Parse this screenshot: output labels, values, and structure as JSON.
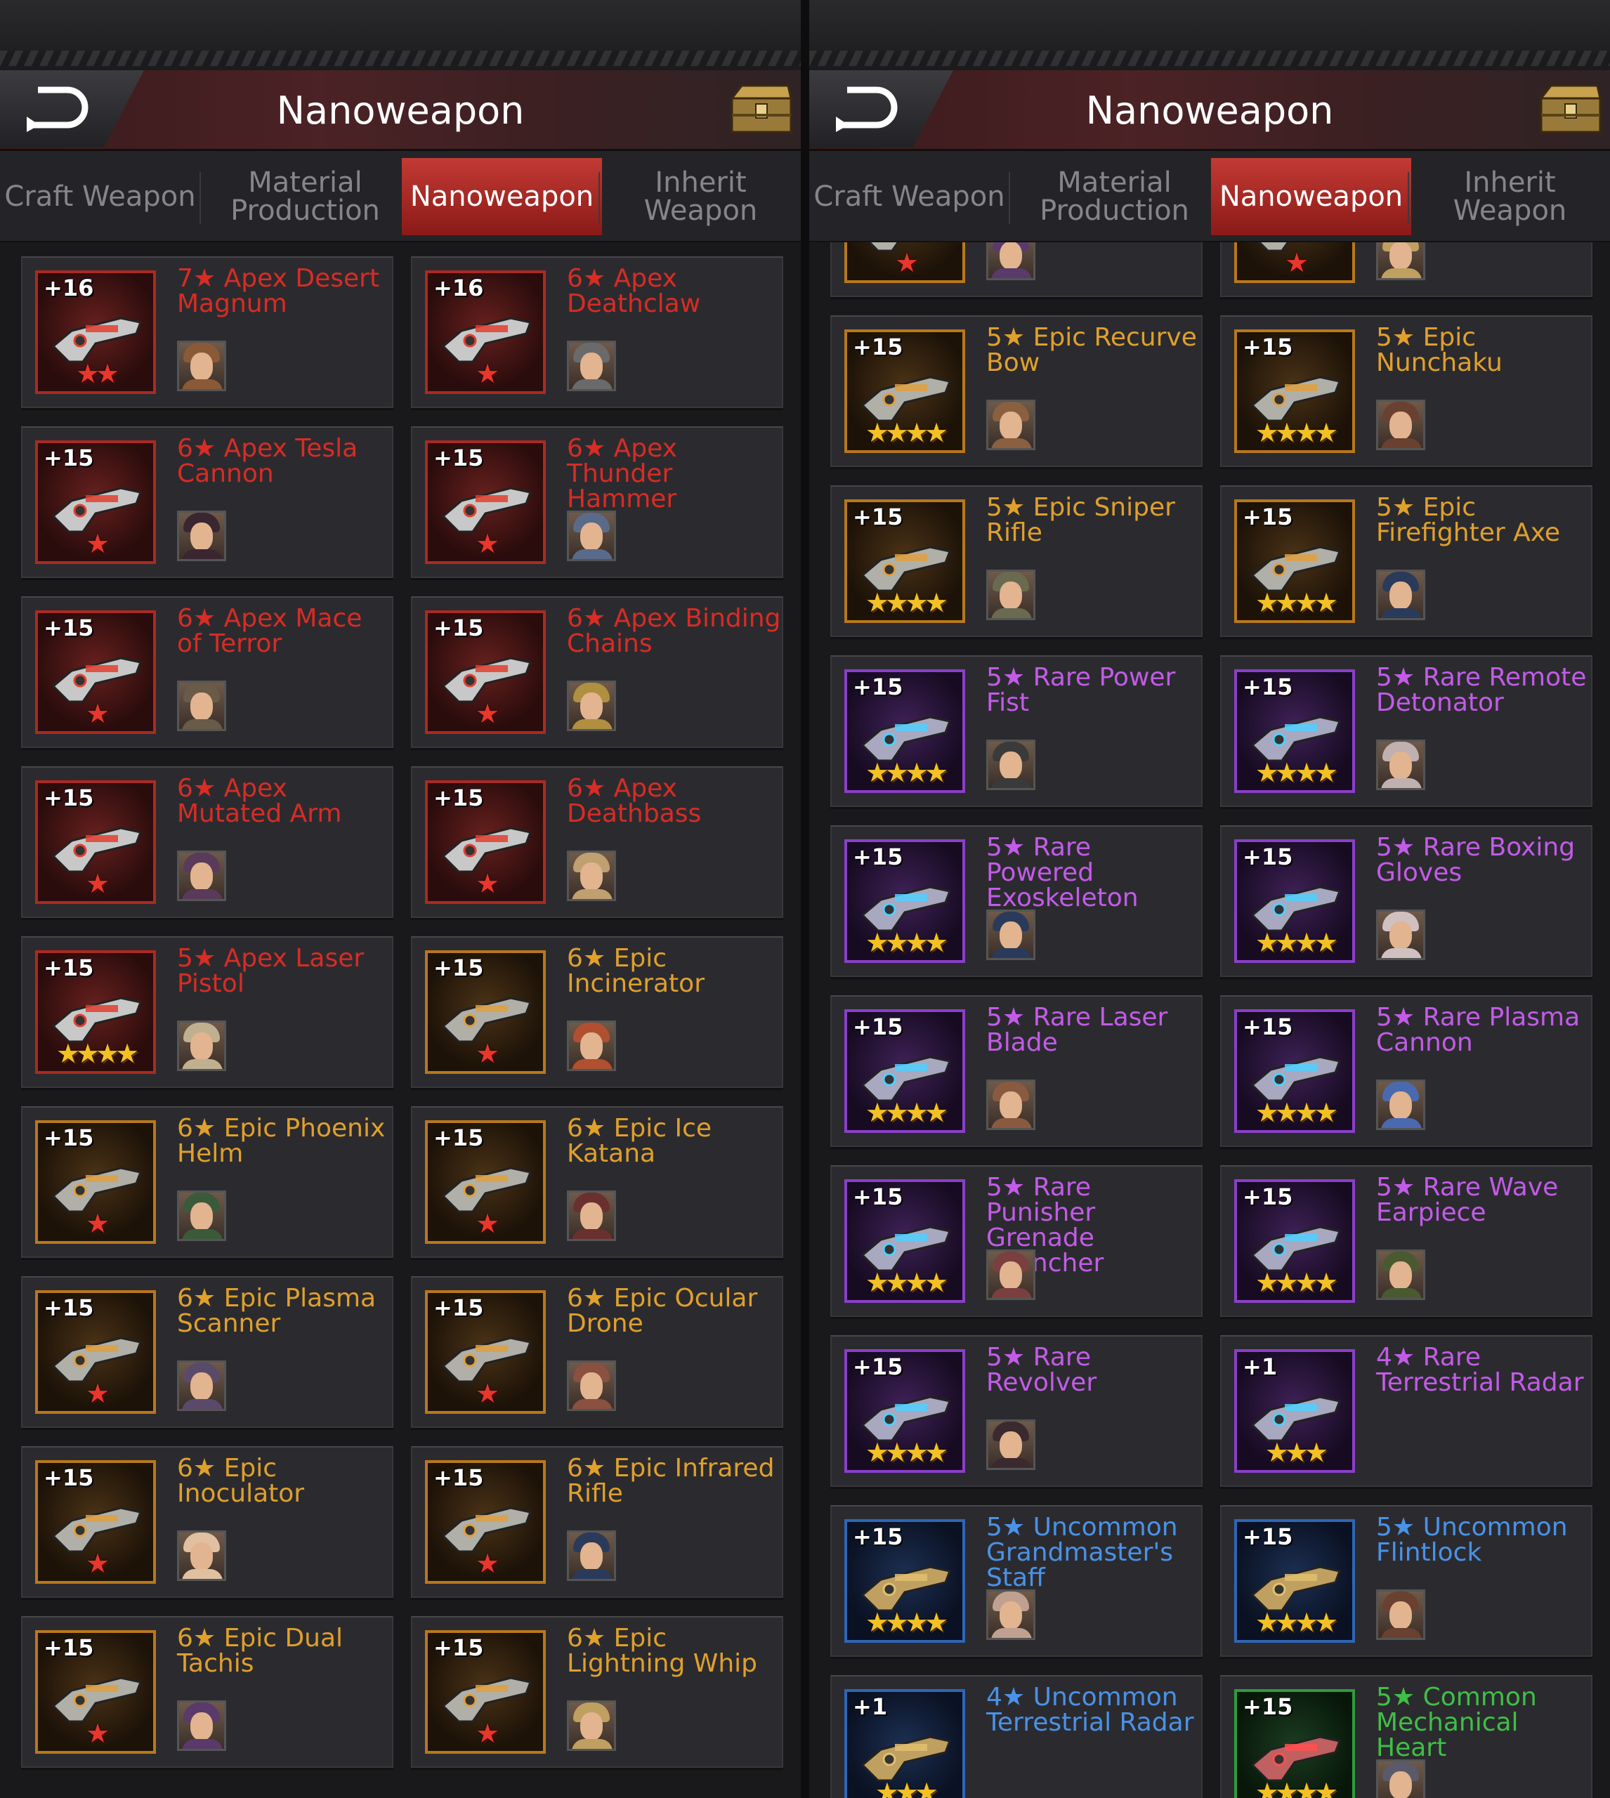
{
  "screens": {
    "left": {
      "title": "Nanoweapon",
      "tabs": [
        {
          "label": "Craft Weapon",
          "active": false
        },
        {
          "label": "Material Production",
          "active": false
        },
        {
          "label": "Nanoweapon",
          "active": true
        },
        {
          "label": "Inherit Weapon",
          "active": false
        }
      ],
      "items": [
        {
          "level": "+16",
          "name": "7★ Apex Desert Magnum",
          "rarity": "apex",
          "stars": "★★",
          "star_color": "red",
          "icon": "desert-magnum-icon",
          "hero_color": "#8a5a38"
        },
        {
          "level": "+16",
          "name": "6★ Apex Deathclaw",
          "rarity": "apex",
          "stars": "★",
          "star_color": "red",
          "icon": "deathclaw-icon",
          "hero_color": "#6a6a6a"
        },
        {
          "level": "+15",
          "name": "6★ Apex Tesla Cannon",
          "rarity": "apex",
          "stars": "★",
          "star_color": "red",
          "icon": "tesla-cannon-icon",
          "hero_color": "#3a2630"
        },
        {
          "level": "+15",
          "name": "6★ Apex Thunder Hammer",
          "rarity": "apex",
          "stars": "★",
          "star_color": "red",
          "icon": "thunder-hammer-icon",
          "hero_color": "#5a6a8a"
        },
        {
          "level": "+15",
          "name": "6★ Apex Mace of Terror",
          "rarity": "apex",
          "stars": "★",
          "star_color": "red",
          "icon": "mace-icon",
          "hero_color": "#6a5a48"
        },
        {
          "level": "+15",
          "name": "6★ Apex Binding Chains",
          "rarity": "apex",
          "stars": "★",
          "star_color": "red",
          "icon": "chains-icon",
          "hero_color": "#b09040"
        },
        {
          "level": "+15",
          "name": "6★ Apex Mutated Arm",
          "rarity": "apex",
          "stars": "★",
          "star_color": "red",
          "icon": "mutated-arm-icon",
          "hero_color": "#5a3a5a"
        },
        {
          "level": "+15",
          "name": "6★ Apex Deathbass",
          "rarity": "apex",
          "stars": "★",
          "star_color": "red",
          "icon": "deathbass-icon",
          "hero_color": "#c0a070"
        },
        {
          "level": "+15",
          "name": "5★ Apex Laser Pistol",
          "rarity": "apex",
          "stars": "★★★★",
          "star_color": "gold",
          "icon": "laser-pistol-icon",
          "hero_color": "#c0b090"
        },
        {
          "level": "+15",
          "name": "6★ Epic Incinerator",
          "rarity": "epic",
          "stars": "★",
          "star_color": "red",
          "icon": "incinerator-icon",
          "hero_color": "#b05030"
        },
        {
          "level": "+15",
          "name": "6★ Epic Phoenix Helm",
          "rarity": "epic",
          "stars": "★",
          "star_color": "red",
          "icon": "phoenix-helm-icon",
          "hero_color": "#3a5a3a"
        },
        {
          "level": "+15",
          "name": "6★ Epic Ice Katana",
          "rarity": "epic",
          "stars": "★",
          "star_color": "red",
          "icon": "ice-katana-icon",
          "hero_color": "#6a3030"
        },
        {
          "level": "+15",
          "name": "6★ Epic Plasma Scanner",
          "rarity": "epic",
          "stars": "★",
          "star_color": "red",
          "icon": "plasma-scanner-icon",
          "hero_color": "#5a4a6a"
        },
        {
          "level": "+15",
          "name": "6★ Epic Ocular Drone",
          "rarity": "epic",
          "stars": "★",
          "star_color": "red",
          "icon": "ocular-drone-icon",
          "hero_color": "#8a5040"
        },
        {
          "level": "+15",
          "name": "6★ Epic Inoculator",
          "rarity": "epic",
          "stars": "★",
          "star_color": "red",
          "icon": "inoculator-icon",
          "hero_color": "#e0c0a0"
        },
        {
          "level": "+15",
          "name": "6★ Epic Infrared Rifle",
          "rarity": "epic",
          "stars": "★",
          "star_color": "red",
          "icon": "infrared-rifle-icon",
          "hero_color": "#2a3a5a"
        },
        {
          "level": "+15",
          "name": "6★ Epic Dual Tachis",
          "rarity": "epic",
          "stars": "★",
          "star_color": "red",
          "icon": "dual-tachis-icon",
          "hero_color": "#5a3a6a"
        },
        {
          "level": "+15",
          "name": "6★ Epic Lightning Whip",
          "rarity": "epic",
          "stars": "★",
          "star_color": "red",
          "icon": "lightning-whip-icon",
          "hero_color": "#c0a060"
        }
      ]
    },
    "right": {
      "title": "Nanoweapon",
      "tabs": [
        {
          "label": "Craft Weapon",
          "active": false
        },
        {
          "label": "Material Production",
          "active": false
        },
        {
          "label": "Nanoweapon",
          "active": true
        },
        {
          "label": "Inherit Weapon",
          "active": false
        }
      ],
      "items": [
        {
          "level": "",
          "name": "",
          "rarity": "epic",
          "stars": "★",
          "star_color": "red",
          "icon": "dual-tachis-icon",
          "hero_color": "#5a3a6a"
        },
        {
          "level": "",
          "name": "",
          "rarity": "epic",
          "stars": "★",
          "star_color": "red",
          "icon": "lightning-whip-icon",
          "hero_color": "#c0a060"
        },
        {
          "level": "+15",
          "name": "5★ Epic Recurve Bow",
          "rarity": "epic",
          "stars": "★★★★",
          "star_color": "gold",
          "icon": "recurve-bow-icon",
          "hero_color": "#8a6040"
        },
        {
          "level": "+15",
          "name": "5★ Epic Nunchaku",
          "rarity": "epic",
          "stars": "★★★★",
          "star_color": "gold",
          "icon": "nunchaku-icon",
          "hero_color": "#6a4030"
        },
        {
          "level": "+15",
          "name": "5★ Epic Sniper Rifle",
          "rarity": "epic",
          "stars": "★★★★",
          "star_color": "gold",
          "icon": "sniper-rifle-icon",
          "hero_color": "#6a6a50"
        },
        {
          "level": "+15",
          "name": "5★ Epic Firefighter Axe",
          "rarity": "epic",
          "stars": "★★★★",
          "star_color": "gold",
          "icon": "firefighter-axe-icon",
          "hero_color": "#2a3a5a"
        },
        {
          "level": "+15",
          "name": "5★ Rare Power Fist",
          "rarity": "rare",
          "stars": "★★★★",
          "star_color": "gold",
          "icon": "power-fist-icon",
          "hero_color": "#3a3a3a"
        },
        {
          "level": "+15",
          "name": "5★ Rare Remote Detonator",
          "rarity": "rare",
          "stars": "★★★★",
          "star_color": "gold",
          "icon": "remote-detonator-icon",
          "hero_color": "#c0b0b0"
        },
        {
          "level": "+15",
          "name": "5★ Rare Powered Exoskeleton",
          "rarity": "rare",
          "stars": "★★★★",
          "star_color": "gold",
          "icon": "exoskeleton-icon",
          "hero_color": "#2a3a5a"
        },
        {
          "level": "+15",
          "name": "5★ Rare Boxing Gloves",
          "rarity": "rare",
          "stars": "★★★★",
          "star_color": "gold",
          "icon": "boxing-gloves-icon",
          "hero_color": "#d0c0c0"
        },
        {
          "level": "+15",
          "name": "5★ Rare Laser Blade",
          "rarity": "rare",
          "stars": "★★★★",
          "star_color": "gold",
          "icon": "laser-blade-icon",
          "hero_color": "#8a5a40"
        },
        {
          "level": "+15",
          "name": "5★ Rare Plasma Cannon",
          "rarity": "rare",
          "stars": "★★★★",
          "star_color": "gold",
          "icon": "plasma-cannon-icon",
          "hero_color": "#4a6ab0"
        },
        {
          "level": "+15",
          "name": "5★ Rare Punisher Grenade Launcher",
          "rarity": "rare",
          "stars": "★★★★",
          "star_color": "gold",
          "icon": "grenade-launcher-icon",
          "hero_color": "#7a4040"
        },
        {
          "level": "+15",
          "name": "5★ Rare Wave Earpiece",
          "rarity": "rare",
          "stars": "★★★★",
          "star_color": "gold",
          "icon": "wave-earpiece-icon",
          "hero_color": "#4a5a30"
        },
        {
          "level": "+15",
          "name": "5★ Rare Revolver",
          "rarity": "rare",
          "stars": "★★★★",
          "star_color": "gold",
          "icon": "revolver-icon",
          "hero_color": "#3a2a30"
        },
        {
          "level": "+1",
          "name": "4★ Rare Terrestrial Radar",
          "rarity": "rare",
          "stars": "★★★",
          "star_color": "gold",
          "icon": "terrestrial-radar-icon",
          "hero_color": ""
        },
        {
          "level": "+15",
          "name": "5★ Uncommon Grandmaster's Staff",
          "rarity": "uncommon",
          "stars": "★★★★",
          "star_color": "gold",
          "icon": "grandmaster-staff-icon",
          "hero_color": "#c0a090"
        },
        {
          "level": "+15",
          "name": "5★ Uncommon Flintlock",
          "rarity": "uncommon",
          "stars": "★★★★",
          "star_color": "gold",
          "icon": "flintlock-icon",
          "hero_color": "#6a4030"
        },
        {
          "level": "+1",
          "name": "4★ Uncommon Terrestrial Radar",
          "rarity": "uncommon",
          "stars": "★★★",
          "star_color": "gold",
          "icon": "terrestrial-radar-icon",
          "hero_color": ""
        },
        {
          "level": "+15",
          "name": "5★ Common Mechanical Heart",
          "rarity": "common",
          "stars": "★★★★",
          "star_color": "gold",
          "icon": "mechanical-heart-icon",
          "hero_color": "#5a5a6a"
        }
      ]
    }
  },
  "colors": {
    "apex": "#d82c24",
    "epic": "#e0a02c",
    "rare": "#c35be8",
    "uncommon": "#4a92e8",
    "common": "#3fbf46",
    "active_tab": "#b52d27"
  }
}
